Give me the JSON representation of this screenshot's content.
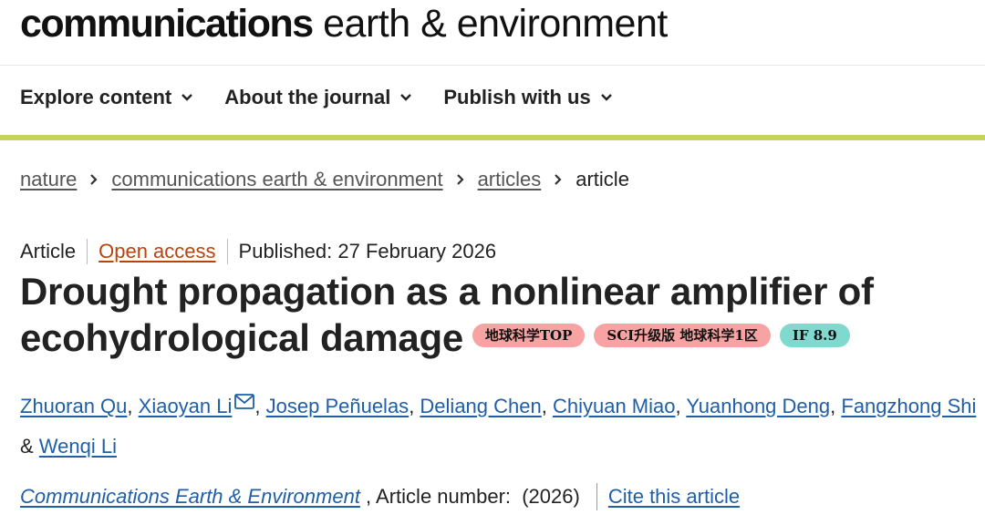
{
  "header": {
    "brand_bold": "communications",
    "brand_light": " earth & environment"
  },
  "nav": {
    "items": [
      {
        "label": "Explore content"
      },
      {
        "label": "About the journal"
      },
      {
        "label": "Publish with us"
      }
    ]
  },
  "breadcrumb": {
    "items": [
      "nature",
      "communications earth & environment",
      "articles"
    ],
    "current": "article"
  },
  "article": {
    "type": "Article",
    "access": "Open access",
    "published": "Published: 27 February 2026",
    "title": "Drought propagation as a nonlinear amplifier of ecohydrological damage",
    "badges": [
      "地球科学TOP",
      "SCI升级版 地球科学1区",
      "IF 8.9"
    ],
    "authors": [
      "Zhuoran Qu",
      "Xiaoyan Li",
      "Josep Peñuelas",
      "Deliang Chen",
      "Chiyuan Miao",
      "Yuanhong Deng",
      "Fangzhong Shi",
      "Wenqi Li"
    ],
    "sep_comma": ", ",
    "sep_and": "& ",
    "journal": "Communications Earth & Environment",
    "article_number": " , Article number:  (2026)",
    "cite": "Cite this article"
  },
  "colors": {
    "accent_bar": "#c5d35b",
    "link": "#1f5fa8",
    "open_access": "#b8440d",
    "badge_pink": "#f7a3a3",
    "badge_teal": "#7fd9cf"
  },
  "icons": [
    "chevron-down-icon",
    "chevron-right-icon",
    "mail-icon"
  ]
}
